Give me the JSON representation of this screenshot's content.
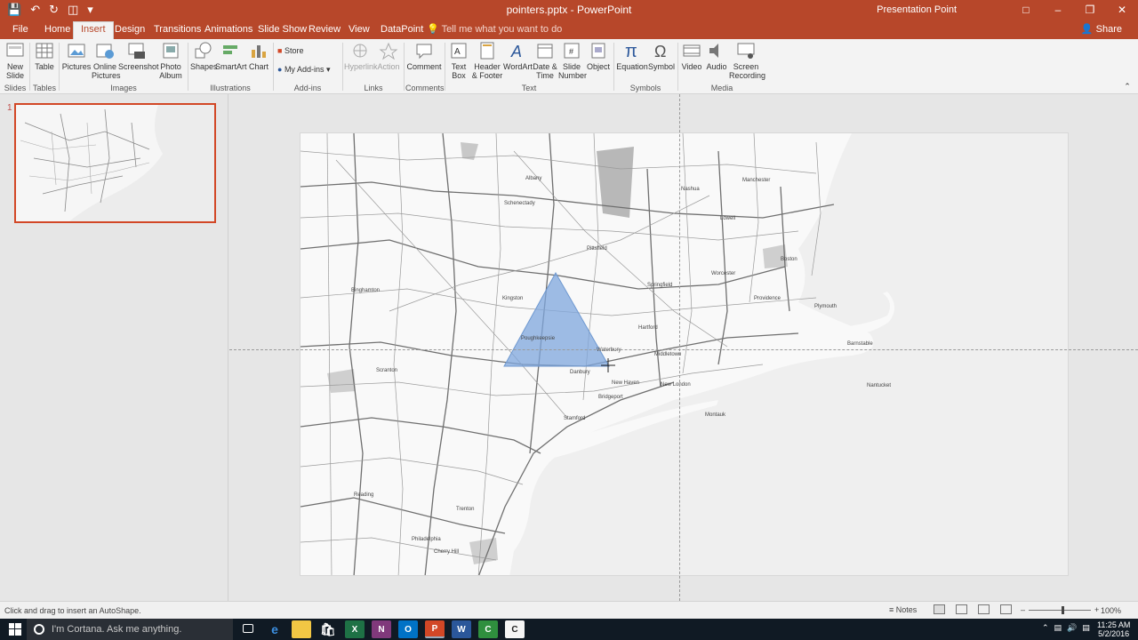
{
  "window": {
    "title": "pointers.pptx - PowerPoint",
    "brand": "Presentation Point",
    "qat_icons": [
      "save-icon",
      "undo-icon",
      "redo-icon",
      "start-from-beginning-icon",
      "customize-icon"
    ]
  },
  "tabs": [
    {
      "label": "File"
    },
    {
      "label": "Home"
    },
    {
      "label": "Insert"
    },
    {
      "label": "Design"
    },
    {
      "label": "Transitions"
    },
    {
      "label": "Animations"
    },
    {
      "label": "Slide Show"
    },
    {
      "label": "Review"
    },
    {
      "label": "View"
    },
    {
      "label": "DataPoint"
    }
  ],
  "tell_me": "Tell me what you want to do",
  "share": "Share",
  "ribbon": {
    "new_slide": "New Slide",
    "table": "Table",
    "pictures": "Pictures",
    "online_pictures": "Online Pictures",
    "screenshot": "Screenshot",
    "photo_album": "Photo Album",
    "shapes": "Shapes",
    "smartart": "SmartArt",
    "chart": "Chart",
    "store": "Store",
    "my_addins": "My Add-ins",
    "hyperlink": "Hyperlink",
    "action": "Action",
    "comment": "Comment",
    "text_box": "Text Box",
    "header_footer": "Header & Footer",
    "wordart": "WordArt",
    "date_time": "Date & Time",
    "slide_number": "Slide Number",
    "object": "Object",
    "equation": "Equation",
    "symbol": "Symbol",
    "video": "Video",
    "audio": "Audio",
    "screen_recording": "Screen Recording",
    "groups": {
      "slides": "Slides",
      "tables": "Tables",
      "images": "Images",
      "illustrations": "Illustrations",
      "addins": "Add-ins",
      "links": "Links",
      "comments": "Comments",
      "text": "Text",
      "symbols": "Symbols",
      "media": "Media"
    }
  },
  "thumbnail": {
    "number": "1"
  },
  "status": {
    "message": "Click and drag to insert an AutoShape.",
    "notes": "Notes",
    "zoom": "100%"
  },
  "taskbar": {
    "search_placeholder": "I'm Cortana. Ask me anything.",
    "time": "11:25 AM",
    "date": "5/2/2016",
    "apps": [
      "task-view-icon",
      "edge-icon",
      "file-explorer-icon",
      "store-icon",
      "excel-icon",
      "onenote-icon",
      "outlook-icon",
      "powerpoint-icon",
      "word-icon",
      "camtasia-icon",
      "app-icon"
    ]
  },
  "map_labels": [
    "Boston",
    "Hartford",
    "Providence",
    "New Haven",
    "Worcester",
    "Springfield",
    "Albany",
    "Danbury",
    "Stamford",
    "Bridgeport",
    "Philadelphia",
    "Scranton",
    "Manchester",
    "Plymouth",
    "Barnstable",
    "Nantucket",
    "Montauk",
    "New London",
    "Binghamton",
    "Reading",
    "Cherry Hill",
    "Trenton",
    "Schenectady",
    "Pittsfield",
    "Lowell",
    "Nashua",
    "Waterbury",
    "Poughkeepsie",
    "Kingston",
    "Middletown"
  ],
  "colors": {
    "accent": "#b7472a",
    "shape_fill": "#7ea6dc",
    "thumb_border": "#d24726"
  }
}
